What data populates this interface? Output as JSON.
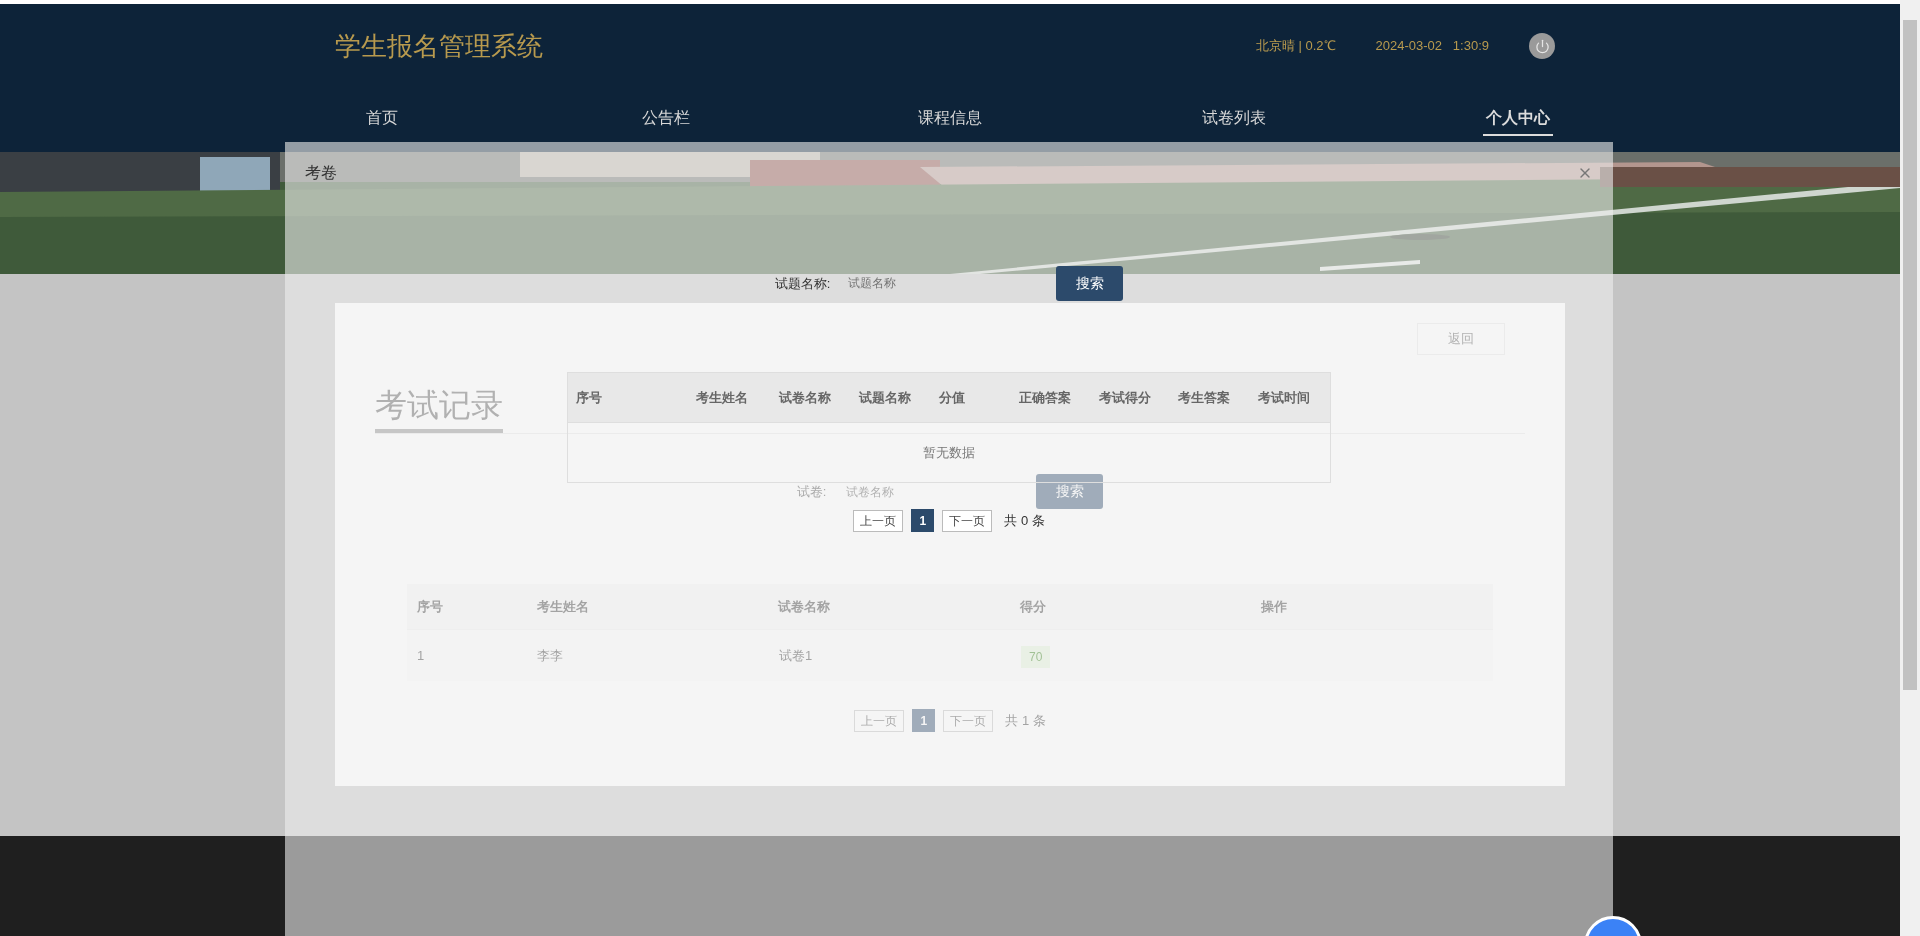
{
  "header": {
    "title": "学生报名管理系统",
    "weather": "北京晴 | 0.2℃",
    "datetime": "2024-03-02   1:30:9"
  },
  "nav": [
    {
      "label": "首页",
      "selected": false
    },
    {
      "label": "公告栏",
      "selected": false
    },
    {
      "label": "课程信息",
      "selected": false
    },
    {
      "label": "试卷列表",
      "selected": false
    },
    {
      "label": "个人中心",
      "selected": true
    }
  ],
  "page": {
    "back_button": "返回",
    "title": "考试记录",
    "search": {
      "label": "试卷:",
      "placeholder": "试卷名称",
      "button": "搜索"
    },
    "table": {
      "columns": [
        "序号",
        "考生姓名",
        "试卷名称",
        "得分",
        "操作"
      ],
      "rows": [
        {
          "index": "1",
          "name": "李李",
          "paper": "试卷1",
          "score": "70"
        }
      ]
    },
    "pagination": {
      "prev": "上一页",
      "pages": [
        {
          "label": "1",
          "selected": true
        }
      ],
      "next": "下一页",
      "total": "共 1 条"
    }
  },
  "modal": {
    "title": "考卷",
    "search": {
      "label": "试题名称:",
      "placeholder": "试题名称",
      "button": "搜索"
    },
    "table": {
      "columns": [
        "序号",
        "考生姓名",
        "试卷名称",
        "试题名称",
        "分值",
        "正确答案",
        "考试得分",
        "考生答案",
        "考试时间"
      ],
      "empty_text": "暂无数据"
    },
    "pagination": {
      "prev": "上一页",
      "pages": [
        {
          "label": "1",
          "selected": true
        }
      ],
      "next": "下一页",
      "total": "共 0 条"
    }
  }
}
